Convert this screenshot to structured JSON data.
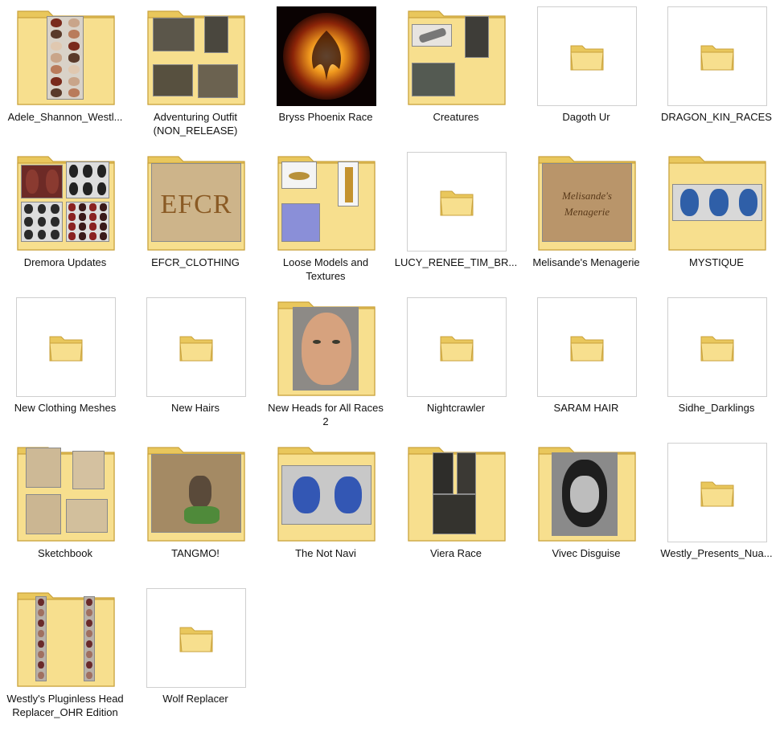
{
  "folders": [
    {
      "name": "Adele_Shannon_Westl...",
      "style": "big",
      "preview": "head-grid"
    },
    {
      "name": "Adventuring Outfit\n(NON_RELEASE)",
      "style": "big",
      "preview": "outfit"
    },
    {
      "name": "Bryss Phoenix Race",
      "style": "image",
      "preview": "phoenix"
    },
    {
      "name": "Creatures",
      "style": "big",
      "preview": "creatures"
    },
    {
      "name": "Dagoth Ur",
      "style": "plain"
    },
    {
      "name": "DRAGON_KIN_RACES",
      "style": "plain"
    },
    {
      "name": "Dremora Updates",
      "style": "big",
      "preview": "masks"
    },
    {
      "name": "EFCR_CLOTHING",
      "style": "big",
      "preview": "parchment-efcr",
      "preview_text": "EFCR"
    },
    {
      "name": "Loose Models and\nTextures",
      "style": "big",
      "preview": "loose"
    },
    {
      "name": "LUCY_RENEE_TIM_BR...",
      "style": "plain"
    },
    {
      "name": "Melisande's Menagerie",
      "style": "big",
      "preview": "parchment-mel",
      "preview_text": "Melisande's Menagerie"
    },
    {
      "name": "MYSTIQUE",
      "style": "big",
      "preview": "blue-heads"
    },
    {
      "name": "New Clothing Meshes",
      "style": "plain"
    },
    {
      "name": "New Hairs",
      "style": "plain"
    },
    {
      "name": "New Heads for All Races\n2",
      "style": "big",
      "preview": "face"
    },
    {
      "name": "Nightcrawler",
      "style": "plain"
    },
    {
      "name": "SARAM HAIR",
      "style": "plain"
    },
    {
      "name": "Sidhe_Darklings",
      "style": "plain"
    },
    {
      "name": "Sketchbook",
      "style": "big",
      "preview": "sketches"
    },
    {
      "name": "TANGMO!",
      "style": "big",
      "preview": "tangmo"
    },
    {
      "name": "The Not Navi",
      "style": "big",
      "preview": "navi"
    },
    {
      "name": "Viera Race",
      "style": "big",
      "preview": "viera"
    },
    {
      "name": "Vivec Disguise",
      "style": "big",
      "preview": "vivec"
    },
    {
      "name": "Westly_Presents_Nua...",
      "style": "plain"
    },
    {
      "name": "Westly's Pluginless Head\nReplacer_OHR Edition",
      "style": "big",
      "preview": "strips"
    },
    {
      "name": "Wolf Replacer",
      "style": "plain"
    }
  ],
  "colors": {
    "folder_back": "#e9c75c",
    "folder_front": "#f7df8e",
    "folder_edge": "#c9a23c",
    "label_text": "#111111"
  },
  "icons": {
    "folder": "folder-icon"
  }
}
